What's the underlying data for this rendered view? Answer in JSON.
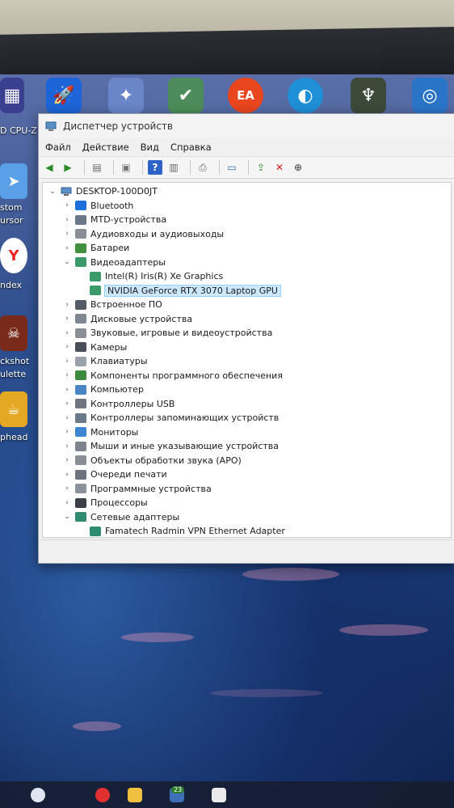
{
  "desktop": {
    "left_labels": [
      "D CPU-Z",
      "stom",
      "ursor",
      "ndex",
      "ckshot",
      "ulette",
      "phead"
    ],
    "taskbar_badge": "23"
  },
  "window": {
    "title": "Диспетчер устройств",
    "menu": [
      "Файл",
      "Действие",
      "Вид",
      "Справка"
    ],
    "root": "DESKTOP-100D0JT",
    "items": [
      {
        "label": "Bluetooth",
        "level": 1,
        "expanded": false,
        "icon": "bluetooth-icon"
      },
      {
        "label": "MTD-устройства",
        "level": 1,
        "expanded": false,
        "icon": "mtd-icon"
      },
      {
        "label": "Аудиовходы и аудиовыходы",
        "level": 1,
        "expanded": false,
        "icon": "speaker-icon"
      },
      {
        "label": "Батареи",
        "level": 1,
        "expanded": false,
        "icon": "battery-icon"
      },
      {
        "label": "Видеоадаптеры",
        "level": 1,
        "expanded": true,
        "icon": "display-adapter-icon"
      },
      {
        "label": "Intel(R) Iris(R) Xe Graphics",
        "level": 2,
        "icon": "display-adapter-icon"
      },
      {
        "label": "NVIDIA GeForce RTX 3070 Laptop GPU",
        "level": 2,
        "icon": "display-adapter-icon",
        "selected": true
      },
      {
        "label": "Встроенное ПО",
        "level": 1,
        "expanded": false,
        "icon": "firmware-icon"
      },
      {
        "label": "Дисковые устройства",
        "level": 1,
        "expanded": false,
        "icon": "disk-icon"
      },
      {
        "label": "Звуковые, игровые и видеоустройства",
        "level": 1,
        "expanded": false,
        "icon": "sound-icon"
      },
      {
        "label": "Камеры",
        "level": 1,
        "expanded": false,
        "icon": "camera-icon"
      },
      {
        "label": "Клавиатуры",
        "level": 1,
        "expanded": false,
        "icon": "keyboard-icon"
      },
      {
        "label": "Компоненты программного обеспечения",
        "level": 1,
        "expanded": false,
        "icon": "software-component-icon"
      },
      {
        "label": "Компьютер",
        "level": 1,
        "expanded": false,
        "icon": "computer-icon"
      },
      {
        "label": "Контроллеры USB",
        "level": 1,
        "expanded": false,
        "icon": "usb-icon"
      },
      {
        "label": "Контроллеры запоминающих устройств",
        "level": 1,
        "expanded": false,
        "icon": "storage-controller-icon"
      },
      {
        "label": "Мониторы",
        "level": 1,
        "expanded": false,
        "icon": "monitor-icon"
      },
      {
        "label": "Мыши и иные указывающие устройства",
        "level": 1,
        "expanded": false,
        "icon": "mouse-icon"
      },
      {
        "label": "Объекты обработки звука (APO)",
        "level": 1,
        "expanded": false,
        "icon": "apo-icon"
      },
      {
        "label": "Очереди печати",
        "level": 1,
        "expanded": false,
        "icon": "printer-icon"
      },
      {
        "label": "Программные устройства",
        "level": 1,
        "expanded": false,
        "icon": "software-device-icon"
      },
      {
        "label": "Процессоры",
        "level": 1,
        "expanded": false,
        "icon": "cpu-icon"
      },
      {
        "label": "Сетевые адаптеры",
        "level": 1,
        "expanded": true,
        "icon": "network-icon"
      },
      {
        "label": "Famatech Radmin VPN Ethernet Adapter",
        "level": 2,
        "icon": "network-icon"
      }
    ]
  }
}
